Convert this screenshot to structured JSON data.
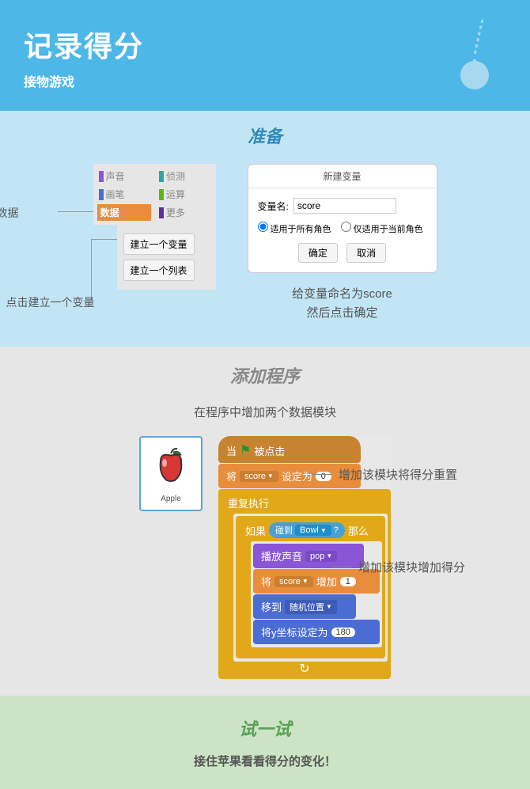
{
  "header": {
    "title": "记录得分",
    "subtitle": "接物游戏"
  },
  "prepare": {
    "title": "准备",
    "categories": {
      "sound": "声音",
      "sensing": "侦测",
      "pen": "画笔",
      "operators": "运算",
      "data": "数据",
      "more": "更多"
    },
    "annotations": {
      "select_data": "选择数据",
      "click_create": "点击建立一个变量"
    },
    "buttons": {
      "create_var": "建立一个变量",
      "create_list": "建立一个列表"
    },
    "dialog": {
      "title": "新建变量",
      "name_label": "变量名:",
      "name_value": "score",
      "radio_all": "适用于所有角色",
      "radio_this": "仅适用于当前角色",
      "ok": "确定",
      "cancel": "取消",
      "caption_line1": "给变量命名为score",
      "caption_line2": "然后点击确定"
    }
  },
  "program": {
    "title": "添加程序",
    "subtitle": "在程序中增加两个数据模块",
    "sprite_name": "Apple",
    "blocks": {
      "when_flag": {
        "prefix": "当",
        "suffix": "被点击"
      },
      "set_var": {
        "prefix": "将",
        "var": "score",
        "mid": "设定为",
        "value": "0"
      },
      "forever": "重复执行",
      "if_touching": {
        "prefix": "如果",
        "mid": "碰到",
        "target": "Bowl",
        "q": "?",
        "suffix": "那么"
      },
      "play_sound": {
        "prefix": "播放声音",
        "sound": "pop"
      },
      "change_var": {
        "prefix": "将",
        "var": "score",
        "mid": "增加",
        "value": "1"
      },
      "goto": {
        "prefix": "移到",
        "target": "随机位置"
      },
      "set_y": {
        "prefix": "将y坐标设定为",
        "value": "180"
      }
    },
    "notes": {
      "reset": "增加该模块将得分重置",
      "increase": "增加该模块增加得分"
    }
  },
  "try": {
    "title": "试一试",
    "text": "接住苹果看看得分的变化！"
  }
}
